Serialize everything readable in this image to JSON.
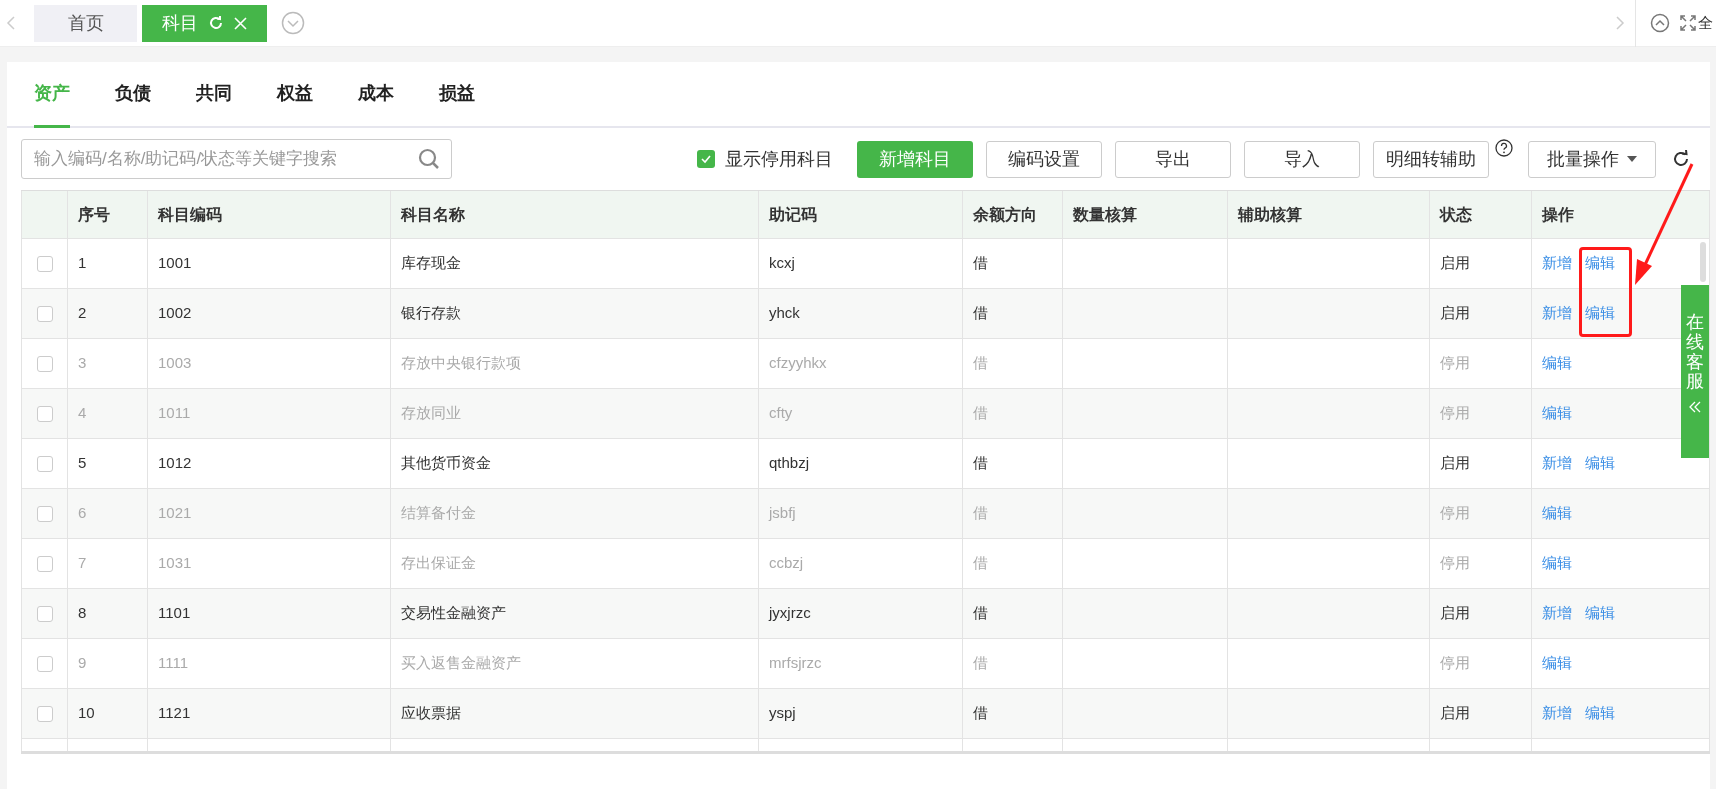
{
  "page_tabs": [
    {
      "label": "首页",
      "selected": false,
      "closable": false
    },
    {
      "label": "科目",
      "selected": true,
      "closable": true
    }
  ],
  "top_right": {
    "fullscreen_label": "全"
  },
  "category_tabs": [
    {
      "label": "资产",
      "selected": true
    },
    {
      "label": "负债",
      "selected": false
    },
    {
      "label": "共同",
      "selected": false
    },
    {
      "label": "权益",
      "selected": false
    },
    {
      "label": "成本",
      "selected": false
    },
    {
      "label": "损益",
      "selected": false
    }
  ],
  "search": {
    "placeholder": "输入编码/名称/助记码/状态等关键字搜索"
  },
  "show_disabled": {
    "label": "显示停用科目",
    "checked": true
  },
  "buttons": [
    {
      "label": "新增科目",
      "kind": "primary"
    },
    {
      "label": "编码设置",
      "kind": "plain"
    },
    {
      "label": "导出",
      "kind": "plain"
    },
    {
      "label": "导入",
      "kind": "plain"
    },
    {
      "label": "明细转辅助",
      "kind": "help"
    },
    {
      "label": "批量操作",
      "kind": "dropdown"
    }
  ],
  "table": {
    "columns": [
      "序号",
      "科目编码",
      "科目名称",
      "助记码",
      "余额方向",
      "数量核算",
      "辅助核算",
      "状态",
      "操作"
    ],
    "rows": [
      {
        "selected": false,
        "enabled": true,
        "cells": [
          "1",
          "1001",
          "库存现金",
          "kcxj",
          "借",
          "",
          "",
          "启用"
        ],
        "actions": [
          "新增",
          "编辑"
        ]
      },
      {
        "selected": false,
        "enabled": true,
        "cells": [
          "2",
          "1002",
          "银行存款",
          "yhck",
          "借",
          "",
          "",
          "启用"
        ],
        "actions": [
          "新增",
          "编辑"
        ]
      },
      {
        "selected": false,
        "enabled": false,
        "cells": [
          "3",
          "1003",
          "存放中央银行款项",
          "cfzyyhkx",
          "借",
          "",
          "",
          "停用"
        ],
        "actions": [
          "编辑"
        ]
      },
      {
        "selected": false,
        "enabled": false,
        "cells": [
          "4",
          "1011",
          "存放同业",
          "cfty",
          "借",
          "",
          "",
          "停用"
        ],
        "actions": [
          "编辑"
        ]
      },
      {
        "selected": false,
        "enabled": true,
        "cells": [
          "5",
          "1012",
          "其他货币资金",
          "qthbzj",
          "借",
          "",
          "",
          "启用"
        ],
        "actions": [
          "新增",
          "编辑"
        ]
      },
      {
        "selected": false,
        "enabled": false,
        "cells": [
          "6",
          "1021",
          "结算备付金",
          "jsbfj",
          "借",
          "",
          "",
          "停用"
        ],
        "actions": [
          "编辑"
        ]
      },
      {
        "selected": false,
        "enabled": false,
        "cells": [
          "7",
          "1031",
          "存出保证金",
          "ccbzj",
          "借",
          "",
          "",
          "停用"
        ],
        "actions": [
          "编辑"
        ]
      },
      {
        "selected": false,
        "enabled": true,
        "cells": [
          "8",
          "1101",
          "交易性金融资产",
          "jyxjrzc",
          "借",
          "",
          "",
          "启用"
        ],
        "actions": [
          "新增",
          "编辑"
        ]
      },
      {
        "selected": false,
        "enabled": false,
        "cells": [
          "9",
          "1111",
          "买入返售金融资产",
          "mrfsjrzc",
          "借",
          "",
          "",
          "停用"
        ],
        "actions": [
          "编辑"
        ]
      },
      {
        "selected": false,
        "enabled": true,
        "cells": [
          "10",
          "1121",
          "应收票据",
          "yspj",
          "借",
          "",
          "",
          "启用"
        ],
        "actions": [
          "新增",
          "编辑"
        ]
      }
    ]
  },
  "side_tab": {
    "label": "在线客服"
  },
  "annotation": {
    "kind": "box_and_arrow"
  }
}
